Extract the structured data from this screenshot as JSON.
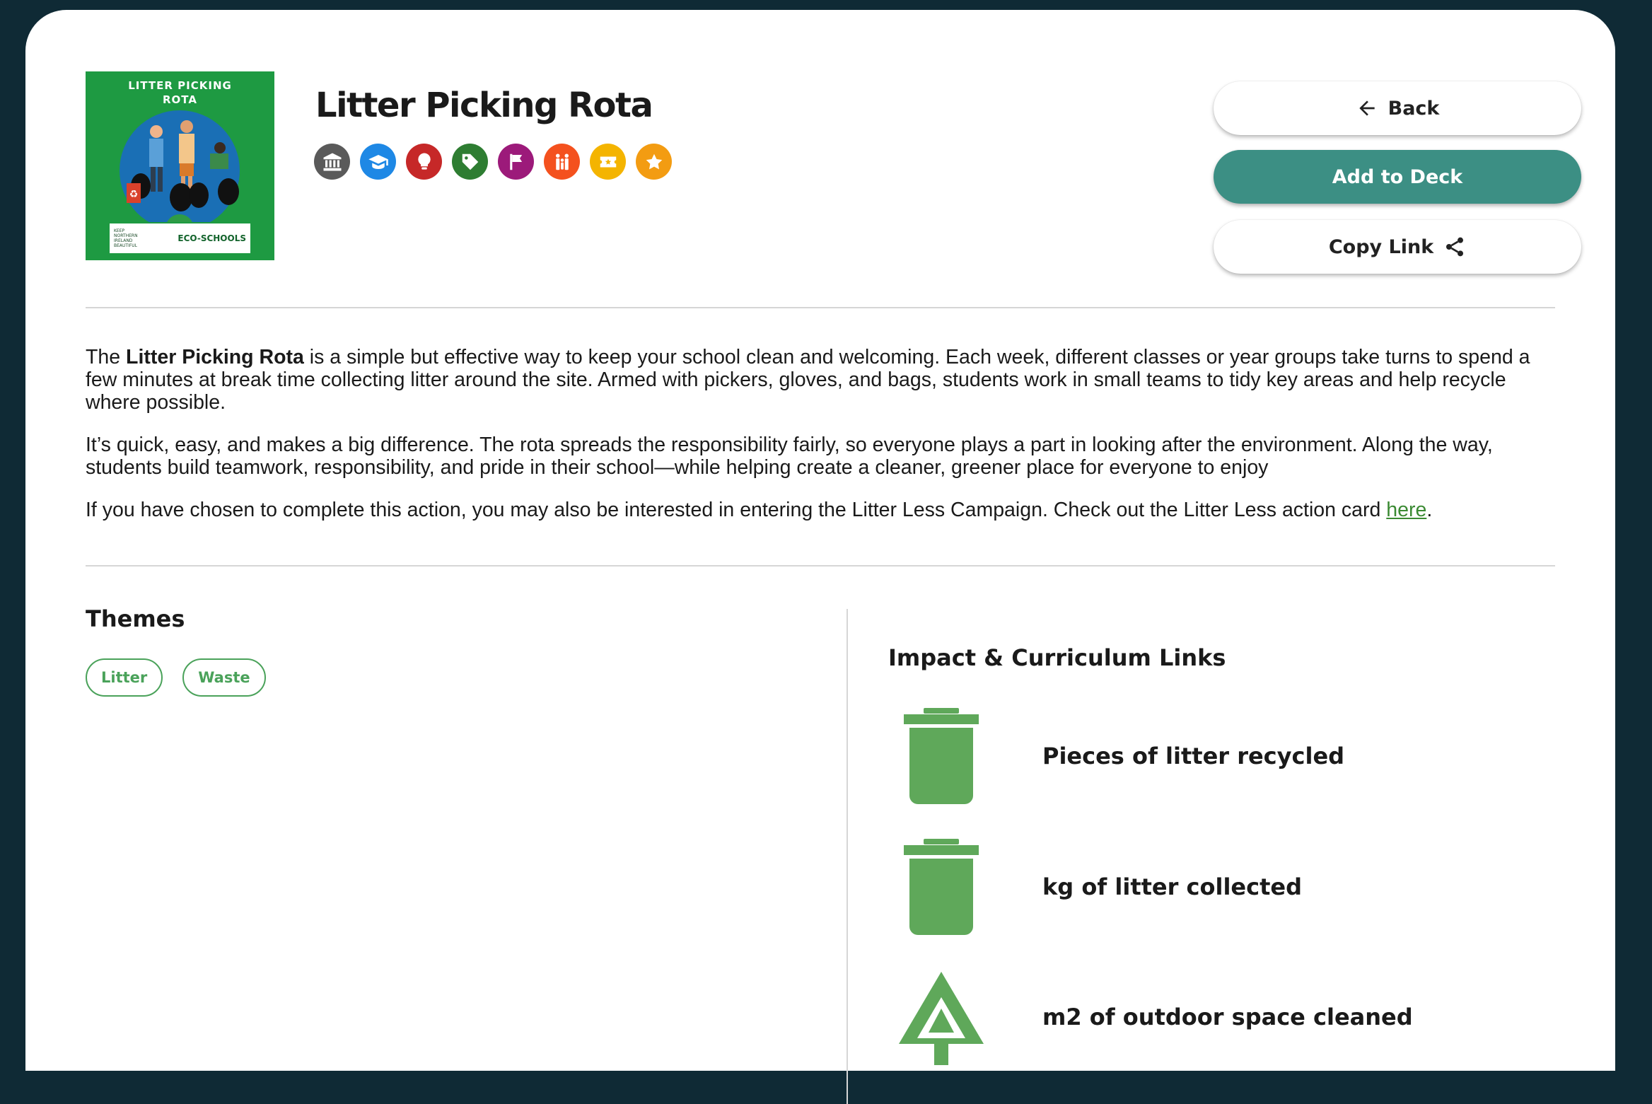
{
  "card": {
    "thumbnail_title": "LITTER PICKING\nROTA",
    "thumbnail_footer_left": "KEEP NORTHERN IRELAND BEAUTIFUL",
    "thumbnail_footer_right": "ECO-SCHOOLS",
    "title": "Litter Picking Rota",
    "category_icons": [
      {
        "name": "institution-icon",
        "color": "#5a5a5a"
      },
      {
        "name": "graduation-cap-icon",
        "color": "#1e88e5"
      },
      {
        "name": "lightbulb-icon",
        "color": "#c62828"
      },
      {
        "name": "tag-icon",
        "color": "#2e7d32"
      },
      {
        "name": "flag-icon",
        "color": "#9c1a7a"
      },
      {
        "name": "people-icon",
        "color": "#f4511e"
      },
      {
        "name": "ticket-icon",
        "color": "#f4b400"
      },
      {
        "name": "star-icon",
        "color": "#f39c12"
      }
    ]
  },
  "actions": {
    "back_label": "Back",
    "add_label": "Add to Deck",
    "copy_label": "Copy Link"
  },
  "description": {
    "p1_prefix": "The ",
    "p1_bold": "Litter Picking Rota",
    "p1_rest": " is a simple but effective way to keep your school clean and welcoming. Each week, different classes or year groups take turns to spend a few minutes at break time collecting litter around the site. Armed with pickers, gloves, and bags, students work in small teams to tidy key areas and help recycle where possible.",
    "p2": "It’s quick, easy, and makes a big difference. The rota spreads the responsibility fairly, so everyone plays a part in looking after the environment. Along the way, students build teamwork, responsibility, and pride in their school—while helping create a cleaner, greener place for everyone to enjoy",
    "p3_text": "If you have chosen to complete this action, you may also be interested in entering the Litter Less Campaign. Check out the Litter Less action card ",
    "p3_link": "here",
    "p3_end": "."
  },
  "themes": {
    "title": "Themes",
    "chips": [
      "Litter",
      "Waste"
    ]
  },
  "impact": {
    "title": "Impact & Curriculum Links",
    "items": [
      {
        "icon": "bin-icon",
        "label": "Pieces of litter recycled"
      },
      {
        "icon": "bin-icon",
        "label": "kg of litter collected"
      },
      {
        "icon": "tree-icon",
        "label": "m2 of outdoor space cleaned"
      }
    ]
  },
  "colors": {
    "background": "#0f2a35",
    "primary": "#3c8f84",
    "green": "#5fa85a",
    "link": "#3b8a33"
  }
}
